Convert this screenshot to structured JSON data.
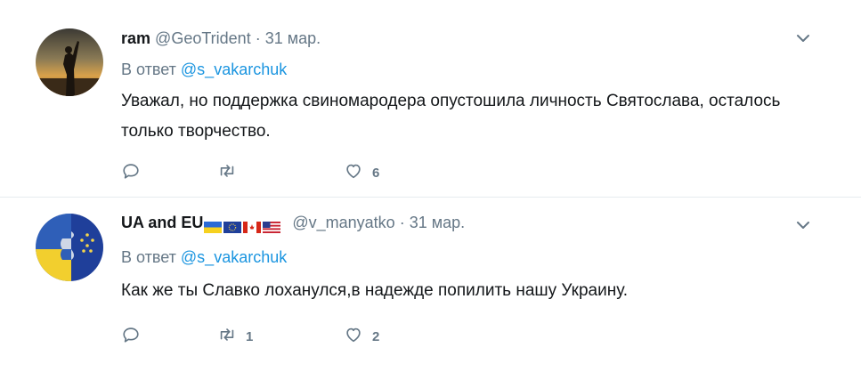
{
  "tweets": [
    {
      "name": "ram",
      "handle": "@GeoTrident",
      "separator": "·",
      "time": "31 мар.",
      "reply_prefix": "В ответ",
      "reply_to": "@s_vakarchuk",
      "text": "Уважал, но поддержка свиномародера опустошила личность Святослава, осталось только творчество.",
      "retweets": "",
      "likes": "6"
    },
    {
      "name": "UA and EU",
      "handle": "@v_manyatko",
      "separator": "·",
      "time": "31 мар.",
      "reply_prefix": "В ответ",
      "reply_to": "@s_vakarchuk",
      "text": "Как же ты Славко лоханулся,в надежде попилить нашу Украину.",
      "retweets": "1",
      "likes": "2"
    }
  ],
  "colors": {
    "link": "#1b95e0",
    "secondary_text": "#657786",
    "divider": "#e6ecf0"
  },
  "icons": [
    "reply-icon",
    "retweet-icon",
    "like-icon",
    "caret-down-icon"
  ]
}
